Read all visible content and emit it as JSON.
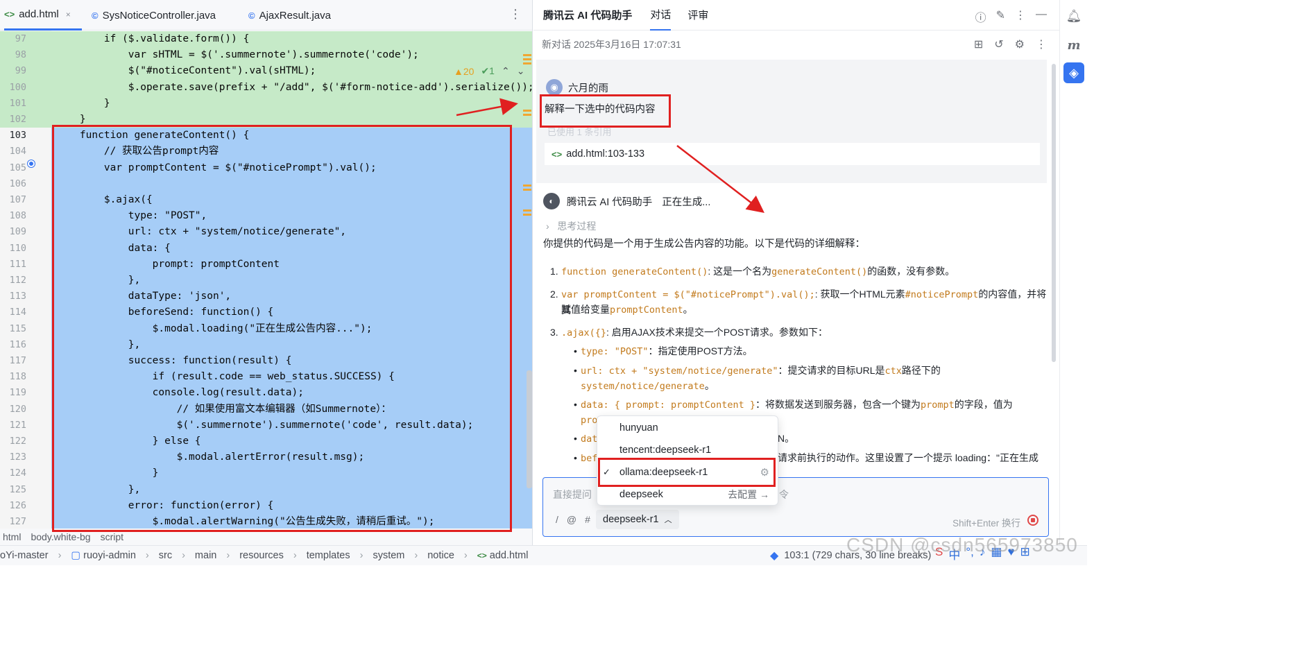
{
  "editor": {
    "tabs": [
      {
        "label": "add.html",
        "icon": "html-file-icon"
      },
      {
        "label": "SysNoticeController.java",
        "icon": "java-class-icon"
      },
      {
        "label": "AjaxResult.java",
        "icon": "java-class-icon"
      }
    ],
    "tab_close": "×",
    "more": "⋮",
    "inspection": {
      "warnings": "▲20",
      "ok": "✔1"
    },
    "lines": [
      {
        "n": "97",
        "t": "        if ($.validate.form()) {"
      },
      {
        "n": "98",
        "t": "            var sHTML = $('.summernote').summernote('code');"
      },
      {
        "n": "99",
        "t": "            $(\"#noticeContent\").val(sHTML);"
      },
      {
        "n": "100",
        "t": "            $.operate.save(prefix + \"/add\", $('#form-notice-add').serialize());"
      },
      {
        "n": "101",
        "t": "        }"
      },
      {
        "n": "102",
        "t": "    }"
      },
      {
        "n": "103",
        "t": "    function generateContent() {"
      },
      {
        "n": "104",
        "t": "        // 获取公告prompt内容"
      },
      {
        "n": "105",
        "t": "        var promptContent = $(\"#noticePrompt\").val();"
      },
      {
        "n": "106",
        "t": ""
      },
      {
        "n": "107",
        "t": "        $.ajax({"
      },
      {
        "n": "108",
        "t": "            type: \"POST\","
      },
      {
        "n": "109",
        "t": "            url: ctx + \"system/notice/generate\","
      },
      {
        "n": "110",
        "t": "            data: {"
      },
      {
        "n": "111",
        "t": "                prompt: promptContent"
      },
      {
        "n": "112",
        "t": "            },"
      },
      {
        "n": "113",
        "t": "            dataType: 'json',"
      },
      {
        "n": "114",
        "t": "            beforeSend: function() {"
      },
      {
        "n": "115",
        "t": "                $.modal.loading(\"正在生成公告内容...\");"
      },
      {
        "n": "116",
        "t": "            },"
      },
      {
        "n": "117",
        "t": "            success: function(result) {"
      },
      {
        "n": "118",
        "t": "                if (result.code == web_status.SUCCESS) {"
      },
      {
        "n": "119",
        "t": "                console.log(result.data);"
      },
      {
        "n": "120",
        "t": "                    // 如果使用富文本编辑器（如Summernote）："
      },
      {
        "n": "121",
        "t": "                    $('.summernote').summernote('code', result.data);"
      },
      {
        "n": "122",
        "t": "                } else {"
      },
      {
        "n": "123",
        "t": "                    $.modal.alertError(result.msg);"
      },
      {
        "n": "124",
        "t": "                }"
      },
      {
        "n": "125",
        "t": "            },"
      },
      {
        "n": "126",
        "t": "            error: function(error) {"
      },
      {
        "n": "127",
        "t": "                $.modal.alertWarning(\"公告生成失败，请稍后重试。\");"
      }
    ],
    "breadcrumb": [
      "html",
      "body.white-bg",
      "script"
    ]
  },
  "assistant": {
    "title": "腾讯云 AI 代码助手",
    "tabs": [
      "对话",
      "评审"
    ],
    "header_icons": [
      "help-icon",
      "edit-icon",
      "more-icon",
      "minimize-icon"
    ],
    "conversation_title": "新对话 2025年3月16日 17:07:31",
    "conversation_icons": [
      "new-chat-icon",
      "history-icon",
      "settings-icon",
      "more-icon"
    ],
    "user": {
      "avatar": "◉",
      "name": "六月的雨",
      "message": "解释一下选中的代码内容",
      "ref_note": "已使用 1 条引用",
      "ref": "add.html:103-133"
    },
    "bot": {
      "name": "腾讯云 AI 代码助手",
      "status": "正在生成...",
      "think": "思考过程",
      "intro": "你提供的代码是一个用于生成公告内容的功能。以下是代码的详细解释：",
      "items": [
        {
          "n": "1.",
          "code": "function generateContent()",
          "text1": ": 这是一个名为",
          "code2": "generateContent()",
          "text2": "的函数，没有参数。"
        },
        {
          "n": "2.",
          "code": "var promptContent = $(\"#noticePrompt\").val();",
          "text1": ": 获取一个HTML元素",
          "code2": "#noticePrompt",
          "text2": "的内容值，并将其",
          "line2": "赋值给变量",
          "code3": "promptContent",
          "text3": "。"
        },
        {
          "n": "3.",
          "code": ".ajax({}",
          "text1": ": 启用AJAX技术来提交一个POST请求。参数如下："
        }
      ],
      "bullets": [
        {
          "code": "type: \"POST\"",
          "text": "：指定使用POST方法。"
        },
        {
          "code": "url: ctx + \"system/notice/generate\"",
          "text": "：提交请求的目标URL是",
          "code2": "ctx",
          "text2": "路径下的",
          "line2code": "system/notice/generate",
          "line2text": "。"
        },
        {
          "code": "data: { prompt: promptContent }",
          "text": "：将数据发送到服务器，包含一个键为",
          "code2": "prompt",
          "text2": "的字段，值为",
          "line2code": "pro"
        },
        {
          "code": "dat",
          "tail": "N。"
        },
        {
          "code": "bef",
          "tail": "请求前执行的动作。这里设置了一个提示 loading：\"正在生成"
        }
      ]
    },
    "input": {
      "placeholder": "直接提问",
      "placeholder_tail": "令",
      "tools": [
        "/",
        "@",
        "#"
      ],
      "model": "deepseek-r1",
      "hint": "Shift+Enter 换行"
    },
    "dropdown": {
      "options": [
        {
          "label": "hunyuan",
          "selected": false
        },
        {
          "label": "tencent:deepseek-r1",
          "selected": false
        },
        {
          "label": "ollama:deepseek-r1",
          "selected": true
        },
        {
          "label": "deepseek",
          "selected": false,
          "action": "去配置 →"
        }
      ],
      "check": "✓",
      "gear": "⚙"
    }
  },
  "right_strip": [
    "notifications-icon",
    "m-plugin-icon",
    "ai-assistant-icon"
  ],
  "status_bar": {
    "crumbs": [
      "oYi-master",
      "ruoyi-admin",
      "src",
      "main",
      "resources",
      "templates",
      "system",
      "notice",
      "add.html"
    ],
    "position": "103:1 (729 chars, 30 line breaks)"
  },
  "watermark": "CSDN @csdn565973850",
  "colors": {
    "selection": "#a6cdf7",
    "added": "#c6eac8",
    "accent": "#3574f0",
    "annotation": "#e02020",
    "code_highlight": "#c27a1c"
  }
}
